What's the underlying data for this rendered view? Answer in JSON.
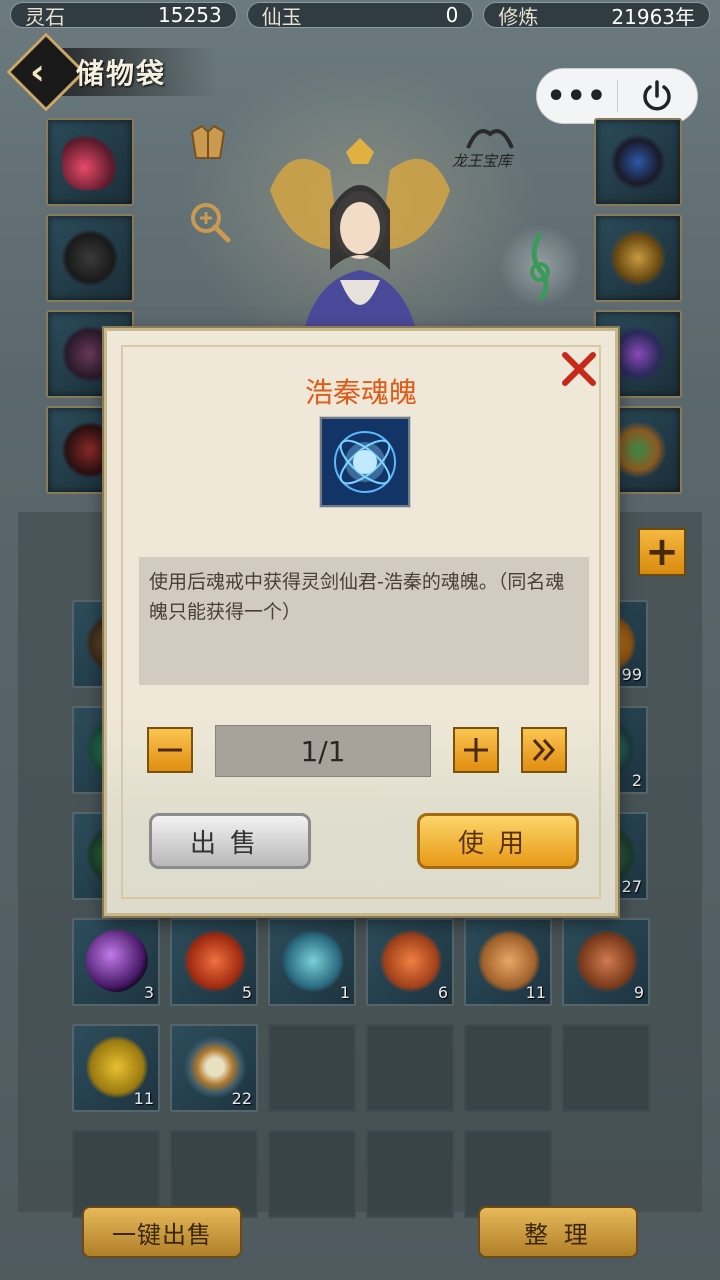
{
  "resources": [
    {
      "label": "灵石",
      "value": "15253"
    },
    {
      "label": "仙玉",
      "value": "0"
    },
    {
      "label": "修炼",
      "value": "21963年"
    }
  ],
  "header": {
    "title": "储物袋",
    "treasury_label": "龙王宝库"
  },
  "capsule": {
    "more_icon": "more-dots-icon",
    "close_icon": "power-icon"
  },
  "inventory": {
    "counts_row1": [
      "",
      "99"
    ],
    "counts_row2": [
      "",
      "2"
    ],
    "counts_row3": [
      "",
      "27"
    ],
    "row4": [
      {
        "icon": "purple-orb-icon",
        "count": "3"
      },
      {
        "icon": "red-fruit-icon",
        "count": "5"
      },
      {
        "icon": "blue-berries-icon",
        "count": "1"
      },
      {
        "icon": "lantern-fruit-icon",
        "count": "6"
      },
      {
        "icon": "yam-icon",
        "count": "11"
      },
      {
        "icon": "pomegranate-icon",
        "count": "9"
      }
    ],
    "row5": [
      {
        "icon": "starfruit-icon",
        "count": "11"
      },
      {
        "icon": "golden-ring-icon",
        "count": "22"
      }
    ]
  },
  "buttons": {
    "sell_all": "一键出售",
    "organize": "整 理"
  },
  "dialog": {
    "title": "浩秦魂魄",
    "description": "使用后魂戒中获得灵剑仙君-浩秦的魂魄。（同名魂魄只能获得一个）",
    "quantity": "1/1",
    "sell_label": "出售",
    "use_label": "使用",
    "colors": {
      "title": "#e05a18",
      "use_button": "#f5b830"
    }
  }
}
